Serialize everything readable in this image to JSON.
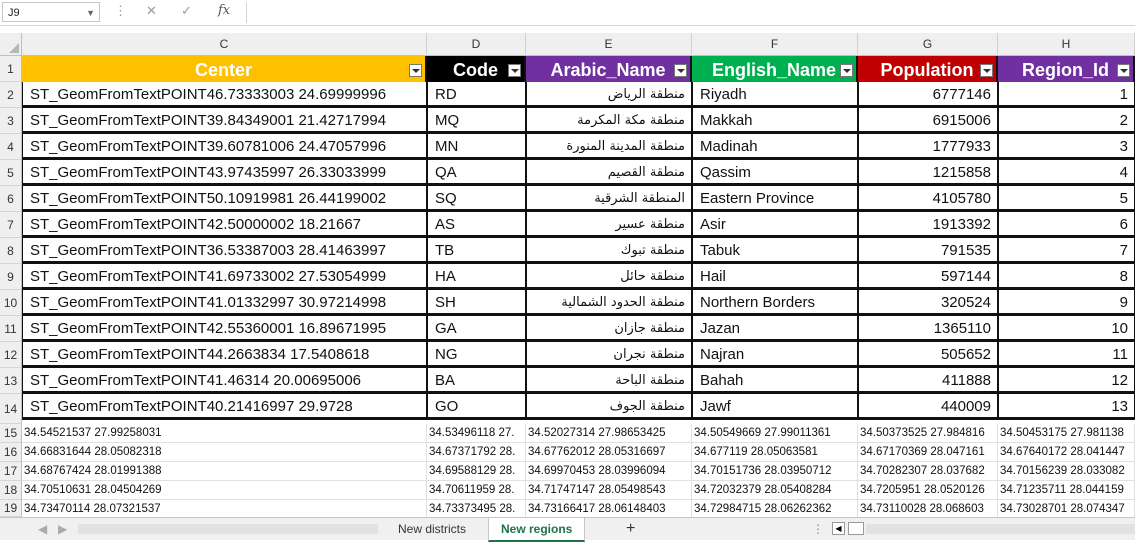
{
  "formula_bar": {
    "name_box": "J9",
    "fx": "fx",
    "cancel": "✕",
    "enter": "✓",
    "dots": "⋮"
  },
  "columns": [
    "C",
    "D",
    "E",
    "F",
    "G",
    "H"
  ],
  "headers": [
    {
      "label": "Center",
      "color": "#ffc000"
    },
    {
      "label": "Code",
      "color": "#000000"
    },
    {
      "label": "Arabic_Name",
      "color": "#7030a0"
    },
    {
      "label": "English_Name",
      "color": "#00b050"
    },
    {
      "label": "Population",
      "color": "#c00000"
    },
    {
      "label": "Region_Id",
      "color": "#7030a0"
    }
  ],
  "rows": [
    [
      "ST_GeomFromTextPOINT46.73333003 24.69999996",
      "RD",
      "منطقة الرياض",
      "Riyadh",
      "6777146",
      "1"
    ],
    [
      "ST_GeomFromTextPOINT39.84349001 21.42717994",
      "MQ",
      "منطقة مكة المكرمة",
      "Makkah",
      "6915006",
      "2"
    ],
    [
      "ST_GeomFromTextPOINT39.60781006 24.47057996",
      "MN",
      "منطقة المدينة المنورة",
      "Madinah",
      "1777933",
      "3"
    ],
    [
      "ST_GeomFromTextPOINT43.97435997 26.33033999",
      "QA",
      "منطقة القصيم",
      "Qassim",
      "1215858",
      "4"
    ],
    [
      "ST_GeomFromTextPOINT50.10919981 26.44199002",
      "SQ",
      "المنطقة الشرقية",
      "Eastern Province",
      "4105780",
      "5"
    ],
    [
      "ST_GeomFromTextPOINT42.50000002 18.21667",
      "AS",
      "منطقة عسير",
      "Asir",
      "1913392",
      "6"
    ],
    [
      "ST_GeomFromTextPOINT36.53387003 28.41463997",
      "TB",
      "منطقة تبوك",
      "Tabuk",
      "791535",
      "7"
    ],
    [
      "ST_GeomFromTextPOINT41.69733002 27.53054999",
      "HA",
      "منطقة حائل",
      "Hail",
      "597144",
      "8"
    ],
    [
      "ST_GeomFromTextPOINT41.01332997 30.97214998",
      "SH",
      "منطقة الحدود الشمالية",
      "Northern Borders",
      "320524",
      "9"
    ],
    [
      "ST_GeomFromTextPOINT42.55360001 16.89671995",
      "GA",
      "منطقة جازان",
      "Jazan",
      "1365110",
      "10"
    ],
    [
      "ST_GeomFromTextPOINT44.2663834 17.5408618",
      "NG",
      "منطقة نجران",
      "Najran",
      "505652",
      "11"
    ],
    [
      "ST_GeomFromTextPOINT41.46314 20.00695006",
      "BA",
      "منطقة الباحة",
      "Bahah",
      "411888",
      "12"
    ],
    [
      "ST_GeomFromTextPOINT40.21416997 29.9728",
      "GO",
      "منطقة الجوف",
      "Jawf",
      "440009",
      "13"
    ]
  ],
  "plain_rows": [
    [
      "34.54521537 27.99258031",
      "34.53496118 27.",
      "34.52027314 27.98653425",
      "34.50549669 27.99011361",
      "34.50373525 27.984816",
      "34.50453175 27.981138"
    ],
    [
      "34.66831644 28.05082318",
      "34.67371792 28.",
      "34.67762012 28.05316697",
      "34.677119 28.05063581",
      "34.67170369 28.047161",
      "34.67640172 28.041447"
    ],
    [
      "34.68767424 28.01991388",
      "34.69588129 28.",
      "34.69970453 28.03996094",
      "34.70151736 28.03950712",
      "34.70282307 28.037682",
      "34.70156239 28.033082"
    ],
    [
      "34.70510631 28.04504269",
      "34.70611959 28.",
      "34.71747147 28.05498543",
      "34.72032379 28.05408284",
      "34.7205951 28.0520126",
      "34.71235711 28.044159"
    ],
    [
      "34.73470114 28.07321537",
      "34.73373495 28.",
      "34.73166417 28.06148403",
      "34.72984715 28.06262362",
      "34.73110028 28.068603",
      "34.73028701 28.074347"
    ]
  ],
  "row_numbers": [
    "1",
    "2",
    "3",
    "4",
    "5",
    "6",
    "7",
    "8",
    "9",
    "10",
    "11",
    "12",
    "13",
    "14",
    "15",
    "16",
    "17",
    "18",
    "19"
  ],
  "tabs": {
    "sheet1": "New districts",
    "sheet2": "New regions",
    "add": "+"
  }
}
